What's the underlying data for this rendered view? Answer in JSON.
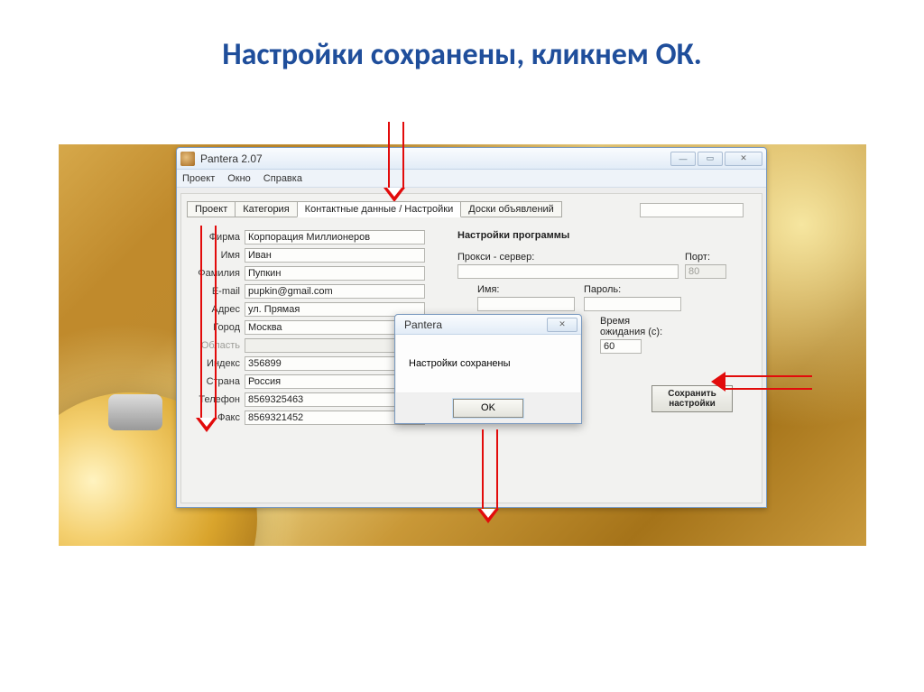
{
  "slide": {
    "title": "Настройки сохранены, кликнем ОК."
  },
  "window": {
    "title": "Pantera 2.07",
    "menu": [
      "Проект",
      "Окно",
      "Справка"
    ],
    "tabs": [
      "Проект",
      "Категория",
      "Контактные данные / Настройки",
      "Доски объявлений"
    ]
  },
  "form": {
    "labels": {
      "firma": "Фирма",
      "name": "Имя",
      "surname": "Фамилия",
      "email": "E-mail",
      "address": "Адрес",
      "city": "Город",
      "region": "Область",
      "index": "Индекс",
      "country": "Страна",
      "phone": "Телефон",
      "fax": "Факс"
    },
    "values": {
      "firma": "Корпорация Миллионеров",
      "name": "Иван",
      "surname": "Пупкин",
      "email": "pupkin@gmail.com",
      "address": "ул. Прямая",
      "city": "Москва",
      "region": "",
      "index": "356899",
      "country": "Россия",
      "phone": "8569325463",
      "fax": "8569321452"
    }
  },
  "settings": {
    "section": "Настройки программы",
    "proxy_label": "Прокси - сервер:",
    "port_label": "Порт:",
    "port_value": "80",
    "login_label": "Имя:",
    "password_label": "Пароль:",
    "wait_label1": "Время",
    "wait_label2": "ожидания (с):",
    "wait_value": "60",
    "save_button": "Сохранить настройки"
  },
  "dialog": {
    "title": "Pantera",
    "message": "Настройки сохранены",
    "ok": "OK"
  }
}
